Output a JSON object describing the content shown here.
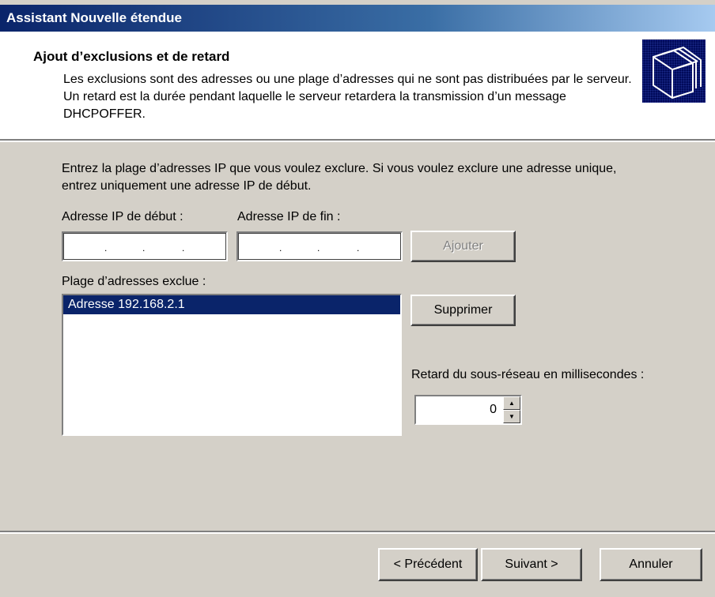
{
  "window": {
    "title": "Assistant Nouvelle étendue"
  },
  "header": {
    "title": "Ajout d’exclusions et de retard",
    "description": "Les exclusions sont des adresses ou une plage d’adresses qui ne sont pas distribuées par le serveur. Un retard est la durée pendant laquelle le serveur retardera la transmission d’un message DHCPOFFER.",
    "icon": "folders-icon"
  },
  "main": {
    "instructions": "Entrez la plage d’adresses IP que vous voulez exclure. Si vous voulez exclure une adresse unique, entrez uniquement une adresse IP de début.",
    "start_ip_label": "Adresse IP de début :",
    "end_ip_label": "Adresse IP de fin :",
    "start_ip_value": "",
    "end_ip_value": "",
    "add_button": "Ajouter",
    "excluded_range_label": "Plage d’adresses exclue :",
    "excluded_list": [
      "Adresse 192.168.2.1"
    ],
    "remove_button": "Supprimer",
    "delay_label": "Retard du sous-réseau en millisecondes :",
    "delay_value": "0"
  },
  "footer": {
    "back_button": "< Précédent",
    "next_button": "Suivant >",
    "cancel_button": "Annuler"
  }
}
